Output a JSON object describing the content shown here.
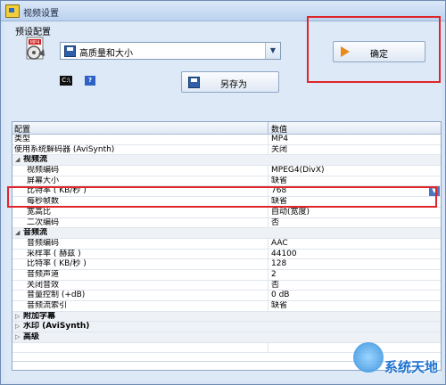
{
  "window": {
    "title": "视频设置"
  },
  "preset": {
    "label": "预设配置",
    "selected": "高质量和大小",
    "save_as_label": "另存为",
    "ok_label": "确定"
  },
  "toolbar": {
    "cmd_icon": "cmd-icon",
    "help_icon": "help-icon",
    "help_glyph": "?"
  },
  "grid": {
    "columns": [
      "配置",
      "数值"
    ],
    "rows": [
      {
        "key": "类型",
        "value": "MP4",
        "type": "plain"
      },
      {
        "key": "使用系统解码器 (AviSynth)",
        "value": "关闭",
        "type": "plain"
      },
      {
        "key": "视频流",
        "value": "",
        "type": "cat",
        "toggle": "◢"
      },
      {
        "key": "视频编码",
        "value": "MPEG4(DivX)",
        "type": "item"
      },
      {
        "key": "屏幕大小",
        "value": "缺省",
        "type": "item"
      },
      {
        "key": "比特率 ( KB/秒 )",
        "value": "768",
        "type": "sel"
      },
      {
        "key": "每秒帧数",
        "value": "缺省",
        "type": "item"
      },
      {
        "key": "宽高比",
        "value": "自动(宽度)",
        "type": "item"
      },
      {
        "key": "二次编码",
        "value": "否",
        "type": "item"
      },
      {
        "key": "音频流",
        "value": "",
        "type": "cat",
        "toggle": "◢"
      },
      {
        "key": "音频编码",
        "value": "AAC",
        "type": "item"
      },
      {
        "key": "采样率 ( 赫兹 )",
        "value": "44100",
        "type": "item"
      },
      {
        "key": "比特率 ( KB/秒 )",
        "value": "128",
        "type": "item"
      },
      {
        "key": "音频声道",
        "value": "2",
        "type": "item"
      },
      {
        "key": "关闭音效",
        "value": "否",
        "type": "item"
      },
      {
        "key": "音量控制 (+dB)",
        "value": "0 dB",
        "type": "item"
      },
      {
        "key": "音频流索引",
        "value": "缺省",
        "type": "item"
      },
      {
        "key": "附加字幕",
        "value": "",
        "type": "cat",
        "toggle": "▷"
      },
      {
        "key": "水印 (AviSynth)",
        "value": "",
        "type": "cat",
        "toggle": "▷"
      },
      {
        "key": "高级",
        "value": "",
        "type": "cat",
        "toggle": "▷"
      },
      {
        "key": "",
        "value": "",
        "type": "plain"
      }
    ]
  },
  "watermark": {
    "text": "系统天地"
  },
  "colors": {
    "highlight_box": "#e0242b",
    "accent": "#e88a18"
  }
}
